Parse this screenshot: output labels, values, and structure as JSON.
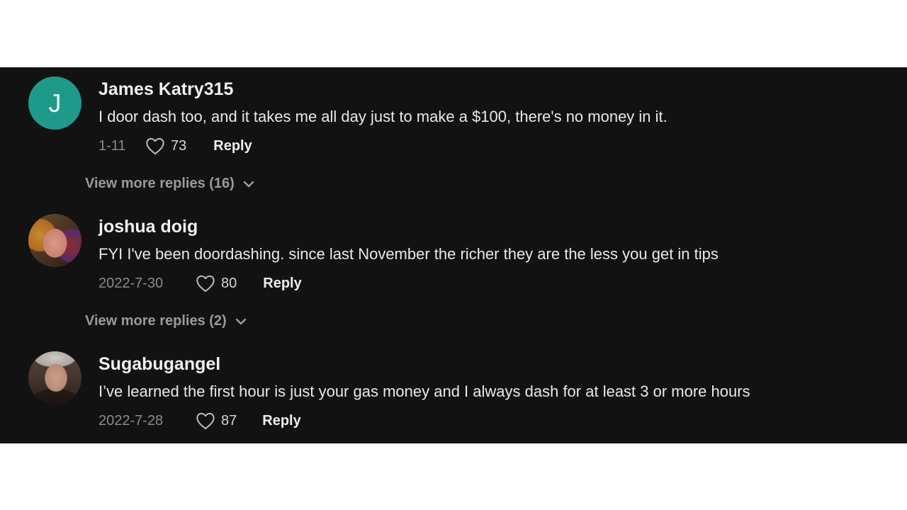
{
  "comments": [
    {
      "avatar": {
        "type": "letter",
        "letter": "J",
        "color": "#1e9a8a"
      },
      "username": "James Katry315",
      "text": "I door dash too, and it takes me all day just to make a $100, there's no money in it.",
      "date": "1-11",
      "likes": "73",
      "reply_label": "Reply",
      "view_more": "View more replies (16)"
    },
    {
      "avatar": {
        "type": "photo"
      },
      "username": "joshua doig",
      "text": "FYI I've been doordashing. since last November the richer they are the less you get in tips",
      "date": "2022-7-30",
      "likes": "80",
      "reply_label": "Reply",
      "view_more": "View more replies (2)"
    },
    {
      "avatar": {
        "type": "photo"
      },
      "username": "Sugabugangel",
      "text": "I’ve learned the first hour is just your gas money and I always dash for at least 3 or more hours",
      "date": "2022-7-28",
      "likes": "87",
      "reply_label": "Reply"
    }
  ]
}
